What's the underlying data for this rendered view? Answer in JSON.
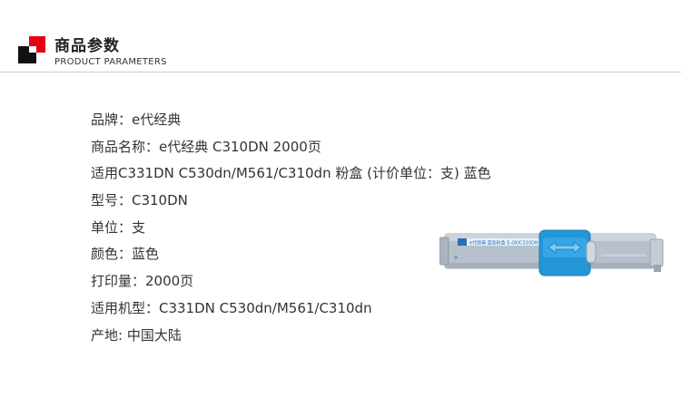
{
  "header": {
    "title": "商品参数",
    "subtitle": "PRODUCT PARAMETERS"
  },
  "specs": [
    "品牌：e代经典",
    "商品名称：e代经典 C310DN 2000页",
    "适用C331DN C530dn/M561/C310dn 粉盒 (计价单位：支) 蓝色",
    "型号：C310DN",
    "单位：支",
    "颜色：蓝色",
    "打印量：2000页",
    "适用机型：C331DN C530dn/M561/C310dn",
    "产地: 中国大陆"
  ],
  "product": {
    "label": "e代经典 蓝色粉盒  E-OKIC310DN",
    "accent_color": "#2596d8",
    "body_color": "#b7c1cc"
  }
}
